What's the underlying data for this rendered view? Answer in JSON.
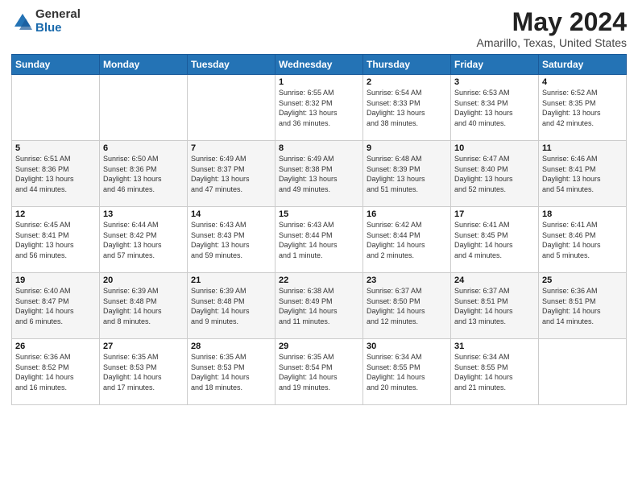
{
  "header": {
    "logo": {
      "general": "General",
      "blue": "Blue"
    },
    "title": "May 2024",
    "subtitle": "Amarillo, Texas, United States"
  },
  "days_of_week": [
    "Sunday",
    "Monday",
    "Tuesday",
    "Wednesday",
    "Thursday",
    "Friday",
    "Saturday"
  ],
  "weeks": [
    [
      {
        "day": "",
        "info": ""
      },
      {
        "day": "",
        "info": ""
      },
      {
        "day": "",
        "info": ""
      },
      {
        "day": "1",
        "info": "Sunrise: 6:55 AM\nSunset: 8:32 PM\nDaylight: 13 hours\nand 36 minutes."
      },
      {
        "day": "2",
        "info": "Sunrise: 6:54 AM\nSunset: 8:33 PM\nDaylight: 13 hours\nand 38 minutes."
      },
      {
        "day": "3",
        "info": "Sunrise: 6:53 AM\nSunset: 8:34 PM\nDaylight: 13 hours\nand 40 minutes."
      },
      {
        "day": "4",
        "info": "Sunrise: 6:52 AM\nSunset: 8:35 PM\nDaylight: 13 hours\nand 42 minutes."
      }
    ],
    [
      {
        "day": "5",
        "info": "Sunrise: 6:51 AM\nSunset: 8:36 PM\nDaylight: 13 hours\nand 44 minutes."
      },
      {
        "day": "6",
        "info": "Sunrise: 6:50 AM\nSunset: 8:36 PM\nDaylight: 13 hours\nand 46 minutes."
      },
      {
        "day": "7",
        "info": "Sunrise: 6:49 AM\nSunset: 8:37 PM\nDaylight: 13 hours\nand 47 minutes."
      },
      {
        "day": "8",
        "info": "Sunrise: 6:49 AM\nSunset: 8:38 PM\nDaylight: 13 hours\nand 49 minutes."
      },
      {
        "day": "9",
        "info": "Sunrise: 6:48 AM\nSunset: 8:39 PM\nDaylight: 13 hours\nand 51 minutes."
      },
      {
        "day": "10",
        "info": "Sunrise: 6:47 AM\nSunset: 8:40 PM\nDaylight: 13 hours\nand 52 minutes."
      },
      {
        "day": "11",
        "info": "Sunrise: 6:46 AM\nSunset: 8:41 PM\nDaylight: 13 hours\nand 54 minutes."
      }
    ],
    [
      {
        "day": "12",
        "info": "Sunrise: 6:45 AM\nSunset: 8:41 PM\nDaylight: 13 hours\nand 56 minutes."
      },
      {
        "day": "13",
        "info": "Sunrise: 6:44 AM\nSunset: 8:42 PM\nDaylight: 13 hours\nand 57 minutes."
      },
      {
        "day": "14",
        "info": "Sunrise: 6:43 AM\nSunset: 8:43 PM\nDaylight: 13 hours\nand 59 minutes."
      },
      {
        "day": "15",
        "info": "Sunrise: 6:43 AM\nSunset: 8:44 PM\nDaylight: 14 hours\nand 1 minute."
      },
      {
        "day": "16",
        "info": "Sunrise: 6:42 AM\nSunset: 8:44 PM\nDaylight: 14 hours\nand 2 minutes."
      },
      {
        "day": "17",
        "info": "Sunrise: 6:41 AM\nSunset: 8:45 PM\nDaylight: 14 hours\nand 4 minutes."
      },
      {
        "day": "18",
        "info": "Sunrise: 6:41 AM\nSunset: 8:46 PM\nDaylight: 14 hours\nand 5 minutes."
      }
    ],
    [
      {
        "day": "19",
        "info": "Sunrise: 6:40 AM\nSunset: 8:47 PM\nDaylight: 14 hours\nand 6 minutes."
      },
      {
        "day": "20",
        "info": "Sunrise: 6:39 AM\nSunset: 8:48 PM\nDaylight: 14 hours\nand 8 minutes."
      },
      {
        "day": "21",
        "info": "Sunrise: 6:39 AM\nSunset: 8:48 PM\nDaylight: 14 hours\nand 9 minutes."
      },
      {
        "day": "22",
        "info": "Sunrise: 6:38 AM\nSunset: 8:49 PM\nDaylight: 14 hours\nand 11 minutes."
      },
      {
        "day": "23",
        "info": "Sunrise: 6:37 AM\nSunset: 8:50 PM\nDaylight: 14 hours\nand 12 minutes."
      },
      {
        "day": "24",
        "info": "Sunrise: 6:37 AM\nSunset: 8:51 PM\nDaylight: 14 hours\nand 13 minutes."
      },
      {
        "day": "25",
        "info": "Sunrise: 6:36 AM\nSunset: 8:51 PM\nDaylight: 14 hours\nand 14 minutes."
      }
    ],
    [
      {
        "day": "26",
        "info": "Sunrise: 6:36 AM\nSunset: 8:52 PM\nDaylight: 14 hours\nand 16 minutes."
      },
      {
        "day": "27",
        "info": "Sunrise: 6:35 AM\nSunset: 8:53 PM\nDaylight: 14 hours\nand 17 minutes."
      },
      {
        "day": "28",
        "info": "Sunrise: 6:35 AM\nSunset: 8:53 PM\nDaylight: 14 hours\nand 18 minutes."
      },
      {
        "day": "29",
        "info": "Sunrise: 6:35 AM\nSunset: 8:54 PM\nDaylight: 14 hours\nand 19 minutes."
      },
      {
        "day": "30",
        "info": "Sunrise: 6:34 AM\nSunset: 8:55 PM\nDaylight: 14 hours\nand 20 minutes."
      },
      {
        "day": "31",
        "info": "Sunrise: 6:34 AM\nSunset: 8:55 PM\nDaylight: 14 hours\nand 21 minutes."
      },
      {
        "day": "",
        "info": ""
      }
    ]
  ]
}
